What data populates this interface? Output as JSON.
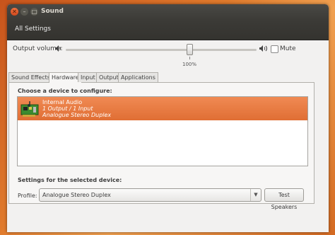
{
  "window": {
    "title": "Sound"
  },
  "toolbar": {
    "all_settings": "All Settings"
  },
  "output": {
    "label": "Output volume:",
    "volume_percent": 100,
    "volume_text": "100%",
    "mute_label": "Mute",
    "muted": false
  },
  "tabs": [
    {
      "label": "Sound Effects",
      "active": false
    },
    {
      "label": "Hardware",
      "active": true
    },
    {
      "label": "Input",
      "active": false
    },
    {
      "label": "Output",
      "active": false
    },
    {
      "label": "Applications",
      "active": false
    }
  ],
  "hardware": {
    "choose_heading": "Choose a device to configure:",
    "device": {
      "name": "Internal Audio",
      "io": "1 Output / 1 Input",
      "profile": "Analogue Stereo Duplex",
      "selected": true
    },
    "settings_heading": "Settings for the selected device:",
    "profile_label": "Profile:",
    "profile_value": "Analogue Stereo Duplex",
    "test_button": "Test Speakers"
  },
  "colors": {
    "selection": "#e8743d",
    "accent_close": "#e0592a",
    "titlebar": "#3c3b37"
  }
}
